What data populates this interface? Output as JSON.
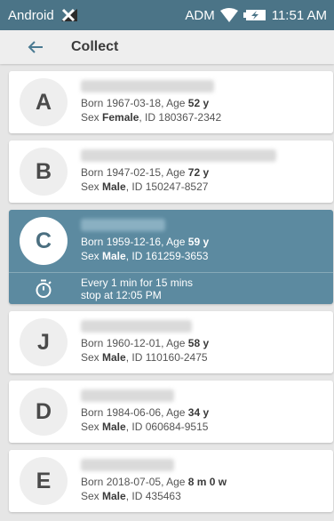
{
  "status_bar": {
    "carrier": "Android",
    "network": "ADM",
    "time": "11:51 AM"
  },
  "app_bar": {
    "title": "Collect"
  },
  "patients": [
    {
      "letter": "A",
      "born_prefix": "Born ",
      "born_date": "1967-03-18",
      "age_prefix": ", Age ",
      "age": "52 y",
      "sex_prefix": "Sex ",
      "sex": "Female",
      "id_prefix": ", ID ",
      "id": "180367-2342"
    },
    {
      "letter": "B",
      "born_prefix": "Born ",
      "born_date": "1947-02-15",
      "age_prefix": ", Age ",
      "age": "72 y",
      "sex_prefix": "Sex ",
      "sex": "Male",
      "id_prefix": ", ID ",
      "id": "150247-8527"
    },
    {
      "letter": "C",
      "born_prefix": "Born ",
      "born_date": "1959-12-16",
      "age_prefix": ", Age ",
      "age": "59 y",
      "sex_prefix": "Sex ",
      "sex": "Male",
      "id_prefix": ", ID ",
      "id": "161259-3653",
      "timer_line1": "Every 1 min for 15 mins",
      "timer_line2": "stop at 12:05 PM"
    },
    {
      "letter": "J",
      "born_prefix": "Born ",
      "born_date": "1960-12-01",
      "age_prefix": ", Age ",
      "age": "58 y",
      "sex_prefix": "Sex ",
      "sex": "Male",
      "id_prefix": ", ID ",
      "id": "110160-2475"
    },
    {
      "letter": "D",
      "born_prefix": "Born ",
      "born_date": "1984-06-06",
      "age_prefix": ", Age ",
      "age": "34 y",
      "sex_prefix": "Sex ",
      "sex": "Male",
      "id_prefix": ", ID ",
      "id": "060684-9515"
    },
    {
      "letter": "E",
      "born_prefix": "Born ",
      "born_date": "2018-07-05",
      "age_prefix": ", Age ",
      "age": "8 m 0 w",
      "sex_prefix": "Sex ",
      "sex": "Male",
      "id_prefix": ", ID ",
      "id": "435463"
    }
  ],
  "colors": {
    "status_bar": "#4b7487",
    "selected_card": "#5c8aa0",
    "background": "#e6e6e6"
  },
  "icons": {
    "back": "arrow-left-icon",
    "timer": "stopwatch-icon",
    "no_signal": "no-signal-icon",
    "wifi": "wifi-icon",
    "battery": "battery-charging-icon"
  }
}
